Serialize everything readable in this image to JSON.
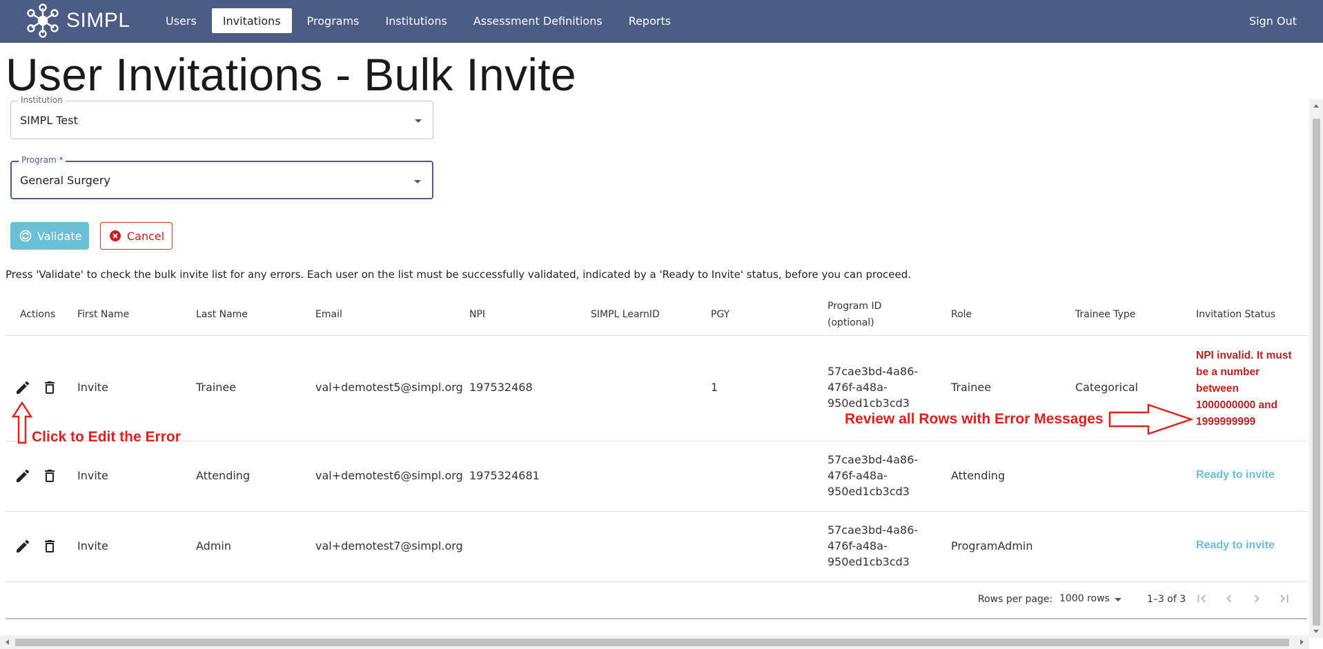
{
  "app": {
    "name": "SIMPL"
  },
  "nav": {
    "items": [
      {
        "label": "Users"
      },
      {
        "label": "Invitations",
        "active": true
      },
      {
        "label": "Programs"
      },
      {
        "label": "Institutions"
      },
      {
        "label": "Assessment Definitions"
      },
      {
        "label": "Reports"
      }
    ],
    "signout": "Sign Out"
  },
  "page": {
    "title": "User Invitations - Bulk Invite"
  },
  "form": {
    "institution": {
      "label": "Institution",
      "value": "SIMPL Test"
    },
    "program": {
      "label": "Program *",
      "value": "General Surgery"
    }
  },
  "buttons": {
    "validate": "Validate",
    "cancel": "Cancel"
  },
  "instruction": "Press 'Validate' to check the bulk invite list for any errors. Each user on the list must be successfully validated, indicated by a 'Ready to Invite' status, before you can proceed.",
  "table": {
    "headers": {
      "actions": "Actions",
      "first_name": "First Name",
      "last_name": "Last Name",
      "email": "Email",
      "npi": "NPI",
      "learn_id": "SIMPL LearnID",
      "pgy": "PGY",
      "program_id_1": "Program ID",
      "program_id_2": "(optional)",
      "role": "Role",
      "trainee_type": "Trainee Type",
      "invitation_status": "Invitation Status"
    },
    "rows": [
      {
        "first_name": "Invite",
        "last_name": "Trainee",
        "email": "val+demotest5@simpl.org",
        "npi": "197532468",
        "learn_id": "",
        "pgy": "1",
        "program_id": [
          "57cae3bd-4a86-",
          "476f-a48a-",
          "950ed1cb3cd3"
        ],
        "role": "Trainee",
        "trainee_type": "Categorical",
        "status_error": [
          "NPI invalid. It must",
          "be a number",
          "between",
          "1000000000 and",
          "1999999999"
        ]
      },
      {
        "first_name": "Invite",
        "last_name": "Attending",
        "email": "val+demotest6@simpl.org",
        "npi": "1975324681",
        "learn_id": "",
        "pgy": "",
        "program_id": [
          "57cae3bd-4a86-",
          "476f-a48a-",
          "950ed1cb3cd3"
        ],
        "role": "Attending",
        "trainee_type": "",
        "status_ok": "Ready to invite"
      },
      {
        "first_name": "Invite",
        "last_name": "Admin",
        "email": "val+demotest7@simpl.org",
        "npi": "",
        "learn_id": "",
        "pgy": "",
        "program_id": [
          "57cae3bd-4a86-",
          "476f-a48a-",
          "950ed1cb3cd3"
        ],
        "role": "ProgramAdmin",
        "trainee_type": "",
        "status_ok": "Ready to invite"
      }
    ]
  },
  "pagination": {
    "rows_per_page_label": "Rows per page:",
    "rows_per_page_value": "1000 rows",
    "range": "1–3 of 3"
  },
  "annotations": {
    "edit_hint": "Click to Edit the Error",
    "review_hint": "Review all Rows with Error Messages"
  },
  "colors": {
    "nav_bg": "#4b5d87",
    "accent": "#6ac1d6",
    "error": "#c21f1f",
    "annotation": "#e02020"
  }
}
